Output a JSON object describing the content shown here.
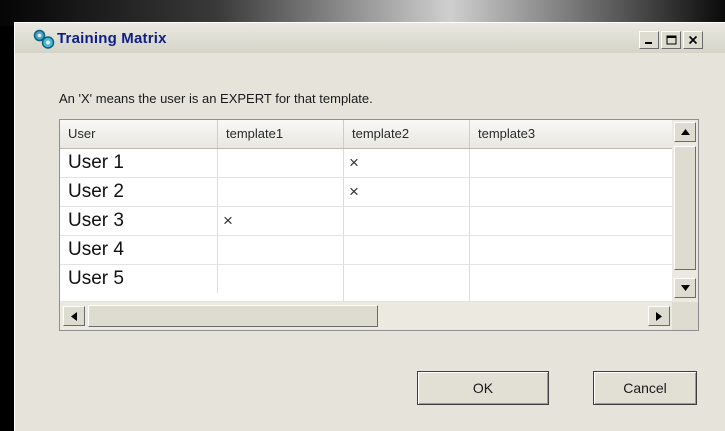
{
  "window": {
    "title": "Training Matrix",
    "controls": {
      "minimize": "_",
      "maximize": "□",
      "close": "x"
    }
  },
  "instructions": "An 'X' means the user is an EXPERT for that template.",
  "grid": {
    "columns": [
      "User",
      "template1",
      "template2",
      "template3"
    ],
    "rows": [
      {
        "user": "User 1",
        "template1": "",
        "template2": "×",
        "template3": ""
      },
      {
        "user": "User 2",
        "template1": "",
        "template2": "×",
        "template3": ""
      },
      {
        "user": "User 3",
        "template1": "×",
        "template2": "",
        "template3": ""
      },
      {
        "user": "User 4",
        "template1": "",
        "template2": "",
        "template3": ""
      },
      {
        "user": "User 5",
        "template1": "",
        "template2": "",
        "template3": ""
      }
    ]
  },
  "buttons": {
    "ok": "OK",
    "cancel": "Cancel"
  },
  "icons": {
    "app": "gears-icon",
    "scroll_up": "arrow-up-icon",
    "scroll_down": "arrow-down-icon",
    "scroll_left": "arrow-left-icon",
    "scroll_right": "arrow-right-icon"
  },
  "colors": {
    "title_text": "#0e1e88",
    "dialog_bg": "#e5e3da",
    "desktop": "#000000"
  }
}
